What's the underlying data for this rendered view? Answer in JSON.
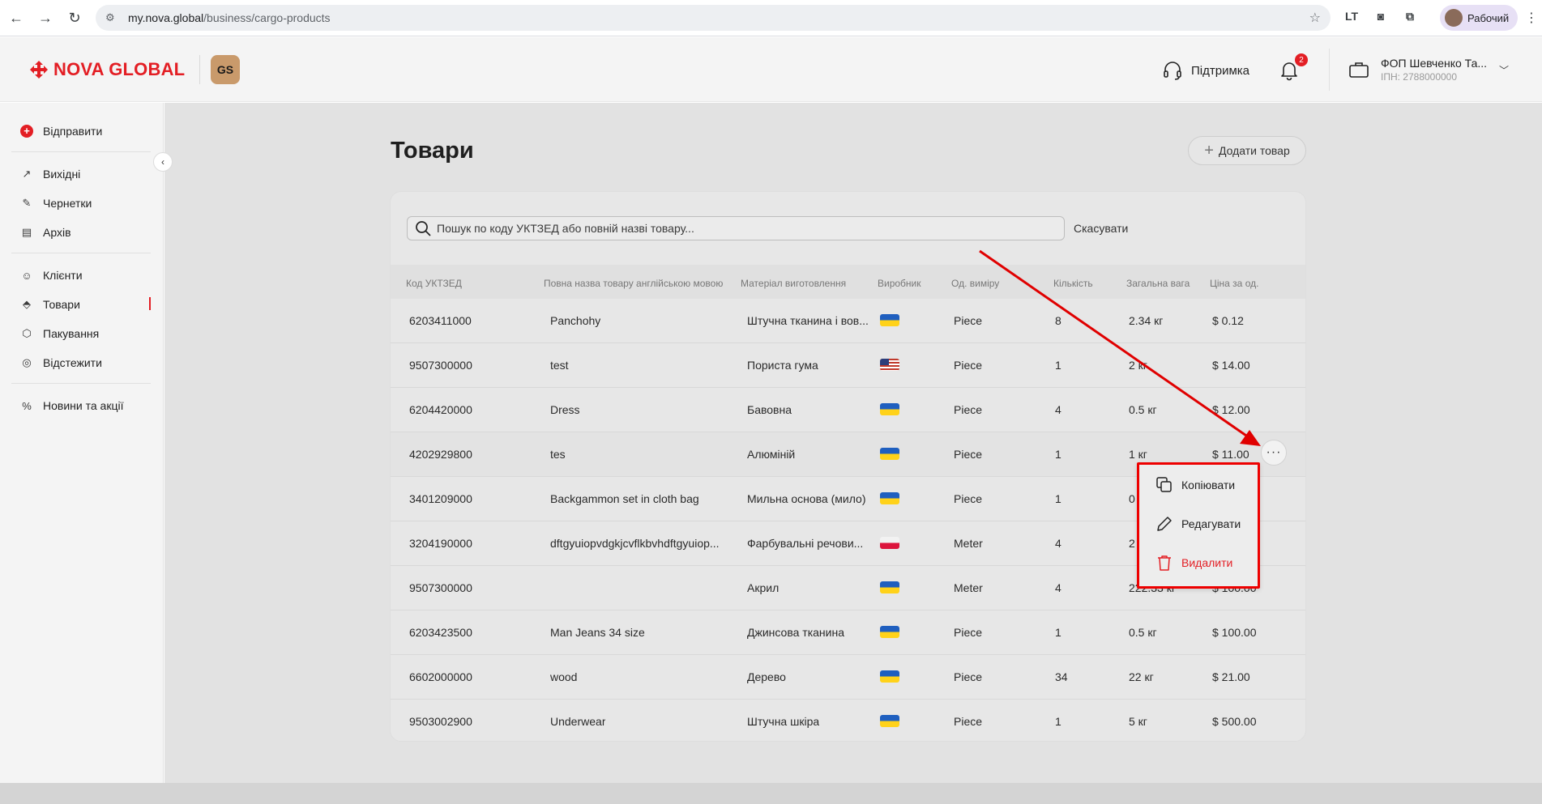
{
  "browser": {
    "url_host": "my.nova.global",
    "url_path": "/business/cargo-products",
    "profile_label": "Рабочий"
  },
  "header": {
    "brand": "NOVA GLOBAL",
    "badge": "GS",
    "support_label": "Підтримка",
    "notifications_count": "2",
    "account_name": "ФОП Шевченко Та...",
    "account_inn": "ІПН: 2788000000"
  },
  "sidebar": {
    "send_label": "Відправити",
    "items": [
      {
        "label": "Вихідні"
      },
      {
        "label": "Чернетки"
      },
      {
        "label": "Архів"
      },
      {
        "label": "Клієнти"
      },
      {
        "label": "Товари"
      },
      {
        "label": "Пакування"
      },
      {
        "label": "Відстежити"
      },
      {
        "label": "Новини та акції"
      }
    ]
  },
  "page": {
    "title": "Товари",
    "add_button": "Додати товар",
    "search_placeholder": "Пошук по коду УКТЗЕД або повній назві товару...",
    "cancel": "Скасувати"
  },
  "table": {
    "columns": [
      "Код УКТЗЕД",
      "Повна назва товару англійською мовою",
      "Матеріал виготовлення",
      "Виробник",
      "Од. виміру",
      "Кількість",
      "Загальна вага",
      "Ціна за од."
    ],
    "rows": [
      {
        "code": "6203411000",
        "name": "Panchohy",
        "material": "Штучна тканина і вов...",
        "flag": "ua",
        "unit": "Piece",
        "qty": "8",
        "weight": "2.34 кг",
        "price": "$ 0.12"
      },
      {
        "code": "9507300000",
        "name": "test",
        "material": "Пориста гума",
        "flag": "us",
        "unit": "Piece",
        "qty": "1",
        "weight": "2 кг",
        "price": "$ 14.00"
      },
      {
        "code": "6204420000",
        "name": "Dress",
        "material": "Бавовна",
        "flag": "ua",
        "unit": "Piece",
        "qty": "4",
        "weight": "0.5 кг",
        "price": "$ 12.00"
      },
      {
        "code": "4202929800",
        "name": "tes",
        "material": "Алюміній",
        "flag": "ua",
        "unit": "Piece",
        "qty": "1",
        "weight": "1 кг",
        "price": "$ 11.00"
      },
      {
        "code": "3401209000",
        "name": "Backgammon set in cloth bag",
        "material": "Мильна основа (мило)",
        "flag": "ua",
        "unit": "Piece",
        "qty": "1",
        "weight": "0",
        "price": ""
      },
      {
        "code": "3204190000",
        "name": "dftgyuiopvdgkjcvflkbvhdftgyuiop...",
        "material": "Фарбувальні речови...",
        "flag": "pl",
        "unit": "Meter",
        "qty": "4",
        "weight": "2",
        "price": ""
      },
      {
        "code": "9507300000",
        "name": "",
        "material": "Акрил",
        "flag": "ua",
        "unit": "Meter",
        "qty": "4",
        "weight": "222.33 кг",
        "price": "$ 100.00"
      },
      {
        "code": "6203423500",
        "name": "Man Jeans 34 size",
        "material": "Джинсова тканина",
        "flag": "ua",
        "unit": "Piece",
        "qty": "1",
        "weight": "0.5 кг",
        "price": "$ 100.00"
      },
      {
        "code": "6602000000",
        "name": "wood",
        "material": "Дерево",
        "flag": "ua",
        "unit": "Piece",
        "qty": "34",
        "weight": "22 кг",
        "price": "$ 21.00"
      },
      {
        "code": "9503002900",
        "name": "Underwear",
        "material": "Штучна шкіра",
        "flag": "ua",
        "unit": "Piece",
        "qty": "1",
        "weight": "5 кг",
        "price": "$ 500.00"
      }
    ]
  },
  "context_menu": {
    "copy": "Копіювати",
    "edit": "Редагувати",
    "delete": "Видалити"
  },
  "colors": {
    "brand_red": "#e31e24",
    "annotation_red": "#e00000"
  }
}
